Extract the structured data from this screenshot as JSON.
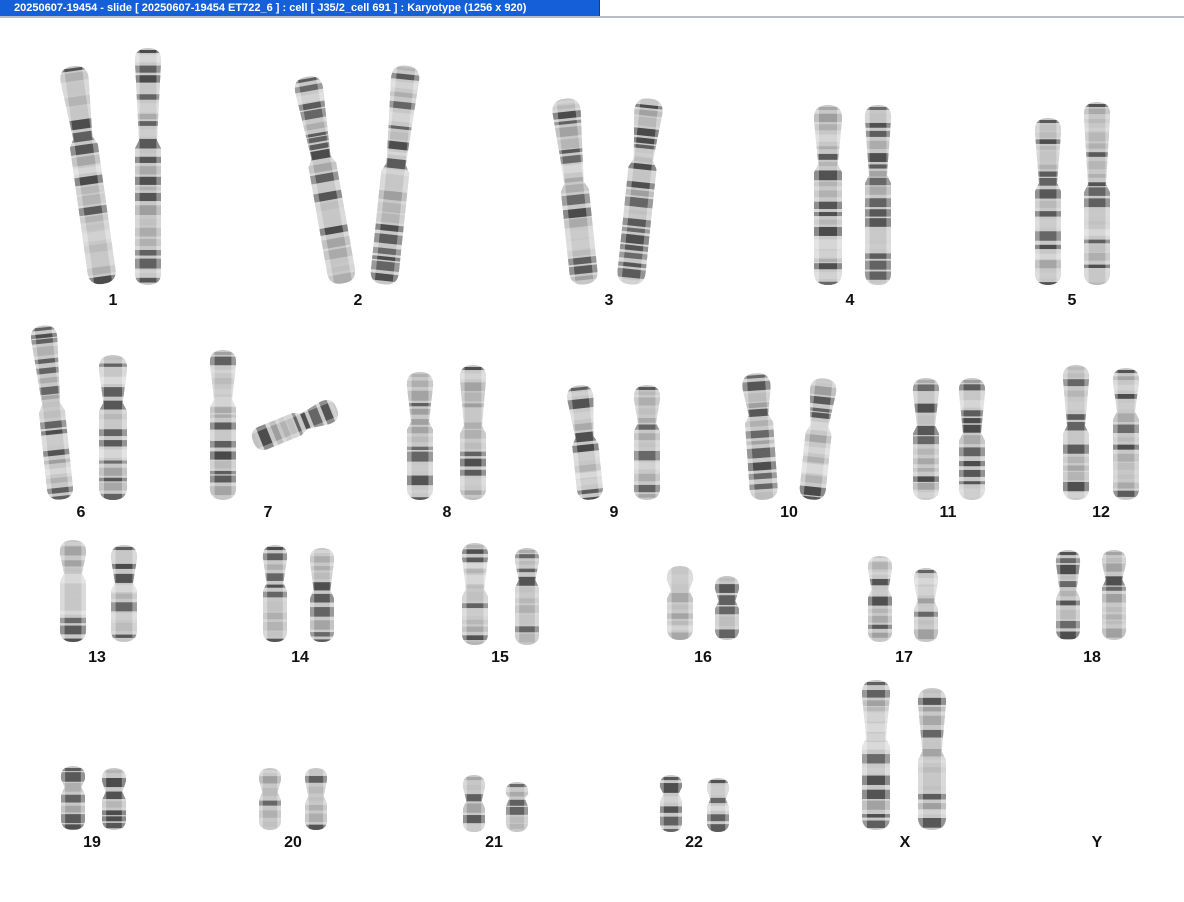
{
  "window": {
    "title": "20250607-19454 - slide [ 20250607-19454 ET722_6 ] : cell [ J35/2_cell 691 ] : Karyotype  (1256 x 920)",
    "accent": "#1560d8"
  },
  "karyotype": {
    "labels": [
      "1",
      "2",
      "3",
      "4",
      "5",
      "6",
      "7",
      "8",
      "9",
      "10",
      "11",
      "12",
      "13",
      "14",
      "15",
      "16",
      "17",
      "18",
      "19",
      "20",
      "21",
      "22",
      "X",
      "Y"
    ]
  }
}
